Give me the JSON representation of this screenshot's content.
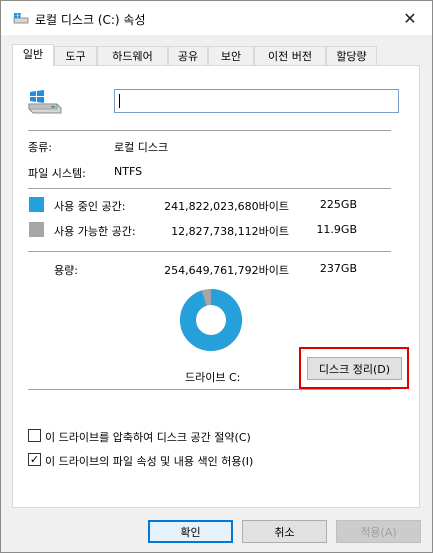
{
  "window": {
    "title": "로컬 디스크 (C:) 속성",
    "close_glyph": "✕"
  },
  "tabs": [
    {
      "label": "일반",
      "active": true
    },
    {
      "label": "도구"
    },
    {
      "label": "하드웨어"
    },
    {
      "label": "공유"
    },
    {
      "label": "보안"
    },
    {
      "label": "이전 버전"
    },
    {
      "label": "할당량"
    }
  ],
  "general": {
    "name_value": "",
    "type_label": "종류:",
    "type_value": "로컬 디스크",
    "fs_label": "파일 시스템:",
    "fs_value": "NTFS",
    "used": {
      "label": "사용 중인 공간:",
      "bytes": "241,822,023,680바이트",
      "size": "225GB",
      "color": "#26a0da"
    },
    "free": {
      "label": "사용 가능한 공간:",
      "bytes": "12,827,738,112바이트",
      "size": "11.9GB",
      "color": "#a6a6a6"
    },
    "capacity": {
      "label": "용량:",
      "bytes": "254,649,761,792바이트",
      "size": "237GB"
    },
    "drive_label": "드라이브 C:",
    "used_fraction": 0.9496,
    "cleanup_button": "디스크 정리(D)",
    "compress_label": "이 드라이브를 압축하여 디스크 공간 절약(C)",
    "compress_checked": false,
    "index_label": "이 드라이브의 파일 속성 및 내용 색인 허용(I)",
    "index_checked": true
  },
  "footer": {
    "ok": "확인",
    "cancel": "취소",
    "apply": "적용(A)"
  },
  "colors": {
    "accent": "#0078d7",
    "highlight": "#e00000"
  }
}
